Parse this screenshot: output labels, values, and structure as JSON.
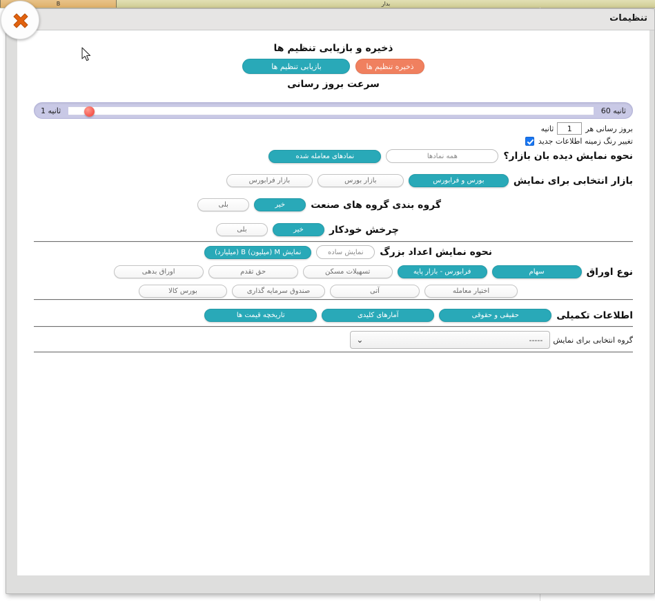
{
  "background": {
    "sheet_columns": [
      "B",
      "بدار"
    ],
    "app_area_label": ""
  },
  "dialog": {
    "title": "تنظیمات",
    "close_icon": "close-x-icon"
  },
  "save_restore": {
    "heading": "ذخیره و بازیابی تنظیم ها",
    "save_label": "ذخیره تنظیم ها",
    "restore_label": "بازیابی تنظیم ها",
    "save_color": "#f0805f",
    "restore_color": "#29a9b8"
  },
  "refresh": {
    "heading": "سرعت بروز رسانی",
    "max_label": "ثانیه 60",
    "min_label": "ثانیه 1",
    "handle_position_percent": 3,
    "handle_color": "#f4564d",
    "interval_prefix": "بروز رسانی هر",
    "interval_value": "1",
    "interval_suffix": "ثانیه",
    "highlight_checkbox_label": "تغییر رنگ زمینه اطلاعات جدید",
    "highlight_checkbox_checked": true
  },
  "watchlist_display": {
    "label": "نحوه نمایش دیده بان بازار؟",
    "options": [
      {
        "label": "همه نمادها",
        "active": false
      },
      {
        "label": "نمادهای معامله شده",
        "active": true
      }
    ]
  },
  "selected_market": {
    "label": "بازار انتخابی برای نمایش",
    "options": [
      {
        "label": "بورس و فرابورس",
        "active": true
      },
      {
        "label": "بازار بورس",
        "active": false
      },
      {
        "label": "بازار فرابورس",
        "active": false
      }
    ]
  },
  "industry_grouping": {
    "label": "گروه بندی گروه های صنعت",
    "options": [
      {
        "label": "خیر",
        "active": true
      },
      {
        "label": "بلی",
        "active": false
      }
    ]
  },
  "auto_rotate": {
    "label": "چرخش خودکار",
    "options": [
      {
        "label": "خیر",
        "active": true
      },
      {
        "label": "بلی",
        "active": false
      }
    ]
  },
  "big_numbers": {
    "label": "نحوه نمایش اعداد بزرگ",
    "options": [
      {
        "label": "نمایش ساده",
        "active": false
      },
      {
        "label": "نمایش M (میلیون) B (میلیارد)",
        "active": true
      }
    ]
  },
  "securities_type": {
    "label": "نوع اوراق",
    "row1": [
      {
        "label": "سهام",
        "active": true
      },
      {
        "label": "فرابورس - بازار پایه",
        "active": true
      },
      {
        "label": "تسهیلات مسکن",
        "active": false
      },
      {
        "label": "حق تقدم",
        "active": false
      },
      {
        "label": "اوراق بدهی",
        "active": false
      }
    ],
    "row2": [
      {
        "label": "اختیار معامله",
        "active": false
      },
      {
        "label": "آتی",
        "active": false
      },
      {
        "label": "صندوق سرمایه گذاری",
        "active": false
      },
      {
        "label": "بورس کالا",
        "active": false
      }
    ]
  },
  "supplementary_info": {
    "label": "اطلاعات تکمیلی",
    "options": [
      {
        "label": "حقیقی و حقوقی",
        "active": true
      },
      {
        "label": "آمارهای کلیدی",
        "active": true
      },
      {
        "label": "تاریخچه قیمت ها",
        "active": true
      }
    ]
  },
  "group_select": {
    "label": "گروه انتخابی برای نمایش",
    "value": "-----",
    "chevron": "⌄"
  }
}
